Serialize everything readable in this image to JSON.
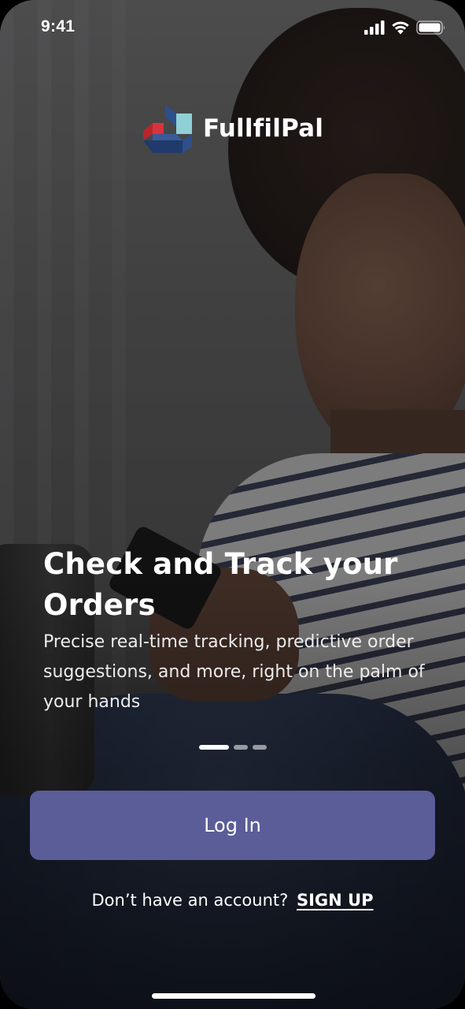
{
  "status_bar": {
    "time": "9:41",
    "icons": [
      "cellular-signal-icon",
      "wifi-icon",
      "battery-icon"
    ]
  },
  "brand": {
    "name": "FullfilPal",
    "logo_colors": {
      "red": "#d8333c",
      "teal": "#8fd0d6",
      "blue": "#2d4f8a",
      "navy": "#1f3a6b"
    }
  },
  "onboarding": {
    "headline_line1": "Check and Track your",
    "headline_line2": "Orders",
    "description": "Precise real-time tracking, predictive order suggestions, and more, right on the palm of your hands",
    "pager": {
      "page_count": 3,
      "active_index": 0
    }
  },
  "actions": {
    "login_label": "Log In",
    "signup_prompt": "Don’t have an account?",
    "signup_label": "SIGN UP"
  },
  "colors": {
    "primary_button": "#5a5d98",
    "text": "#ffffff"
  }
}
